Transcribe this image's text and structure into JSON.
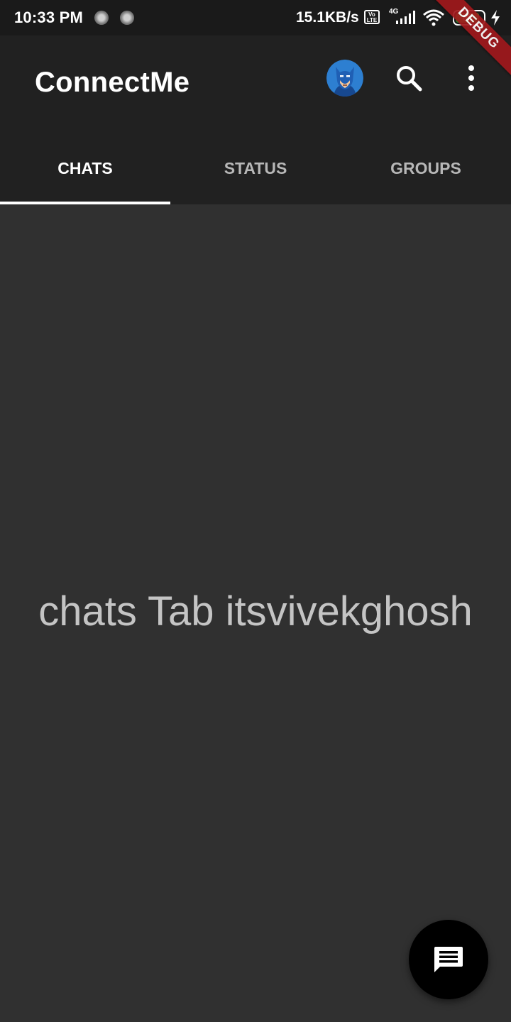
{
  "status_bar": {
    "time": "10:33 PM",
    "net_speed": "15.1KB/s",
    "volte": "Vo LTE",
    "network_type": "4G",
    "battery": "88",
    "icons": [
      "notification-dot-icon",
      "notification-dot-icon",
      "volte-icon",
      "signal-icon",
      "wifi-icon",
      "battery-icon",
      "charging-icon"
    ]
  },
  "app_bar": {
    "title": "ConnectMe",
    "avatar_icon": "batman-avatar",
    "search_icon": "search-icon",
    "more_icon": "more-vert-icon",
    "background": "#212121"
  },
  "tabs": [
    {
      "label": "CHATS",
      "active": true
    },
    {
      "label": "STATUS",
      "active": false
    },
    {
      "label": "GROUPS",
      "active": false
    }
  ],
  "main": {
    "text": "chats Tab itsvivekghosh",
    "background": "#303030"
  },
  "fab": {
    "icon": "message-icon",
    "color": "#000000"
  },
  "debug_banner": {
    "label": "DEBUG",
    "color": "#a0181c"
  }
}
